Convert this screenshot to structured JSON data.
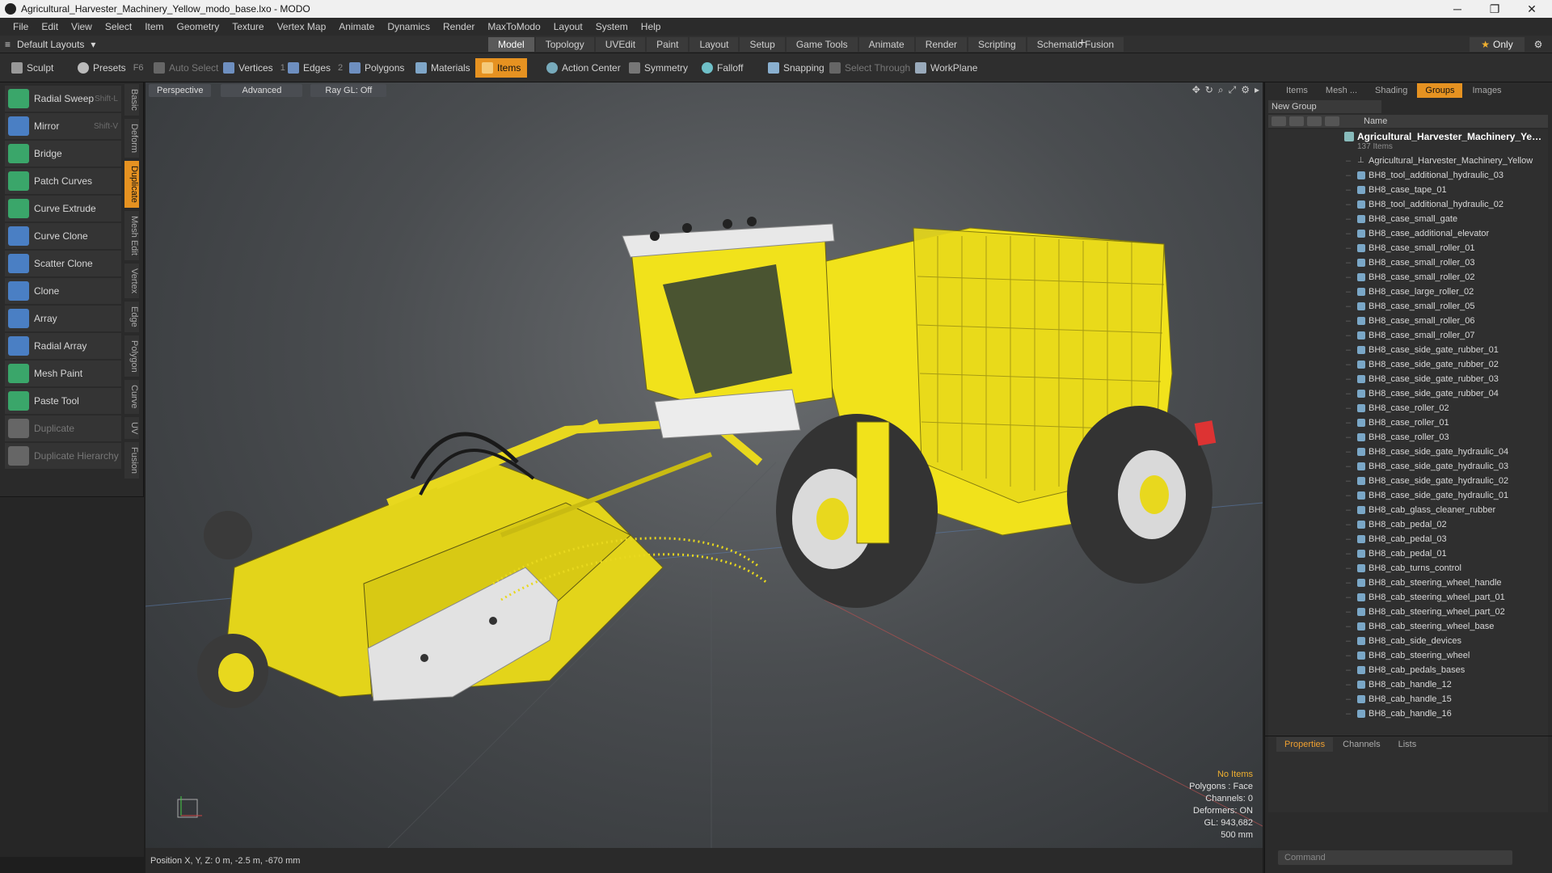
{
  "window": {
    "title": "Agricultural_Harvester_Machinery_Yellow_modo_base.lxo - MODO",
    "minimize": "─",
    "maximize": "❐",
    "close": "✕"
  },
  "menu": [
    "File",
    "Edit",
    "View",
    "Select",
    "Item",
    "Geometry",
    "Texture",
    "Vertex Map",
    "Animate",
    "Dynamics",
    "Render",
    "MaxToModo",
    "Layout",
    "System",
    "Help"
  ],
  "layout_selector": "Default Layouts",
  "tabs": [
    {
      "label": "Model",
      "active": true
    },
    {
      "label": "Topology"
    },
    {
      "label": "UVEdit"
    },
    {
      "label": "Paint"
    },
    {
      "label": "Layout"
    },
    {
      "label": "Setup"
    },
    {
      "label": "Game Tools"
    },
    {
      "label": "Animate"
    },
    {
      "label": "Render"
    },
    {
      "label": "Scripting"
    },
    {
      "label": "Schematic Fusion"
    }
  ],
  "only_button": "Only",
  "toolbar": {
    "sculpt": "Sculpt",
    "presets": "Presets",
    "presets_key": "F6",
    "auto_select": "Auto Select",
    "vertices": "Vertices",
    "vertices_count": "1",
    "edges": "Edges",
    "edges_count": "2",
    "polygons": "Polygons",
    "materials": "Materials",
    "items": "Items",
    "action_center": "Action Center",
    "symmetry": "Symmetry",
    "falloff": "Falloff",
    "snapping": "Snapping",
    "select_through": "Select Through",
    "workplane": "WorkPlane"
  },
  "tools": [
    {
      "label": "Radial Sweep",
      "shortcut": "Shift-L",
      "color": "#3aa66a"
    },
    {
      "label": "Mirror",
      "shortcut": "Shift-V",
      "color": "#4a7fc4"
    },
    {
      "label": "Bridge",
      "shortcut": "",
      "color": "#3aa66a"
    },
    {
      "label": "Patch Curves",
      "shortcut": "",
      "color": "#3aa66a"
    },
    {
      "label": "Curve Extrude",
      "shortcut": "",
      "color": "#3aa66a"
    },
    {
      "label": "Curve Clone",
      "shortcut": "",
      "color": "#4a7fc4"
    },
    {
      "label": "Scatter Clone",
      "shortcut": "",
      "color": "#4a7fc4"
    },
    {
      "label": "Clone",
      "shortcut": "",
      "color": "#4a7fc4"
    },
    {
      "label": "Array",
      "shortcut": "",
      "color": "#4a7fc4"
    },
    {
      "label": "Radial Array",
      "shortcut": "",
      "color": "#4a7fc4"
    },
    {
      "label": "Mesh Paint",
      "shortcut": "",
      "color": "#3aa66a"
    },
    {
      "label": "Paste Tool",
      "shortcut": "",
      "color": "#3aa66a"
    },
    {
      "label": "Duplicate",
      "shortcut": "",
      "color": "#666666",
      "disabled": true
    },
    {
      "label": "Duplicate Hierarchy",
      "shortcut": "",
      "color": "#666666",
      "disabled": true
    }
  ],
  "side_tabs": [
    {
      "label": "Basic"
    },
    {
      "label": "Deform"
    },
    {
      "label": "Duplicate",
      "active": true
    },
    {
      "label": "Mesh Edit"
    },
    {
      "label": "Vertex"
    },
    {
      "label": "Edge"
    },
    {
      "label": "Polygon"
    },
    {
      "label": "Curve"
    },
    {
      "label": "UV"
    },
    {
      "label": "Fusion"
    }
  ],
  "viewport": {
    "perspective": "Perspective",
    "advanced": "Advanced",
    "raygl": "Ray GL: Off",
    "info": {
      "no_items": "No Items",
      "polygons": "Polygons : Face",
      "channels": "Channels: 0",
      "deformers": "Deformers: ON",
      "gl": "GL: 943,682",
      "scale": "500 mm"
    }
  },
  "position": "Position X, Y, Z:   0 m, -2.5 m, -670 mm",
  "right_tabs": [
    {
      "label": "Items"
    },
    {
      "label": "Mesh ..."
    },
    {
      "label": "Shading"
    },
    {
      "label": "Groups",
      "active": true
    },
    {
      "label": "Images"
    }
  ],
  "new_group": "New Group",
  "name_header": "Name",
  "tree": {
    "root": "Agricultural_Harvester_Machinery_Yellow",
    "count": "137 Items",
    "items": [
      "Agricultural_Harvester_Machinery_Yellow",
      "BH8_tool_additional_hydraulic_03",
      "BH8_case_tape_01",
      "BH8_tool_additional_hydraulic_02",
      "BH8_case_small_gate",
      "BH8_case_additional_elevator",
      "BH8_case_small_roller_01",
      "BH8_case_small_roller_03",
      "BH8_case_small_roller_02",
      "BH8_case_large_roller_02",
      "BH8_case_small_roller_05",
      "BH8_case_small_roller_06",
      "BH8_case_small_roller_07",
      "BH8_case_side_gate_rubber_01",
      "BH8_case_side_gate_rubber_02",
      "BH8_case_side_gate_rubber_03",
      "BH8_case_side_gate_rubber_04",
      "BH8_case_roller_02",
      "BH8_case_roller_01",
      "BH8_case_roller_03",
      "BH8_case_side_gate_hydraulic_04",
      "BH8_case_side_gate_hydraulic_03",
      "BH8_case_side_gate_hydraulic_02",
      "BH8_case_side_gate_hydraulic_01",
      "BH8_cab_glass_cleaner_rubber",
      "BH8_cab_pedal_02",
      "BH8_cab_pedal_03",
      "BH8_cab_pedal_01",
      "BH8_cab_turns_control",
      "BH8_cab_steering_wheel_handle",
      "BH8_cab_steering_wheel_part_01",
      "BH8_cab_steering_wheel_part_02",
      "BH8_cab_steering_wheel_base",
      "BH8_cab_side_devices",
      "BH8_cab_steering_wheel",
      "BH8_cab_pedals_bases",
      "BH8_cab_handle_12",
      "BH8_cab_handle_15",
      "BH8_cab_handle_16"
    ]
  },
  "bottom_tabs": [
    {
      "label": "Properties",
      "active": true
    },
    {
      "label": "Channels"
    },
    {
      "label": "Lists"
    }
  ],
  "command_placeholder": "Command",
  "colors": {
    "accent": "#e69221",
    "model_yellow": "#f2e41c"
  }
}
